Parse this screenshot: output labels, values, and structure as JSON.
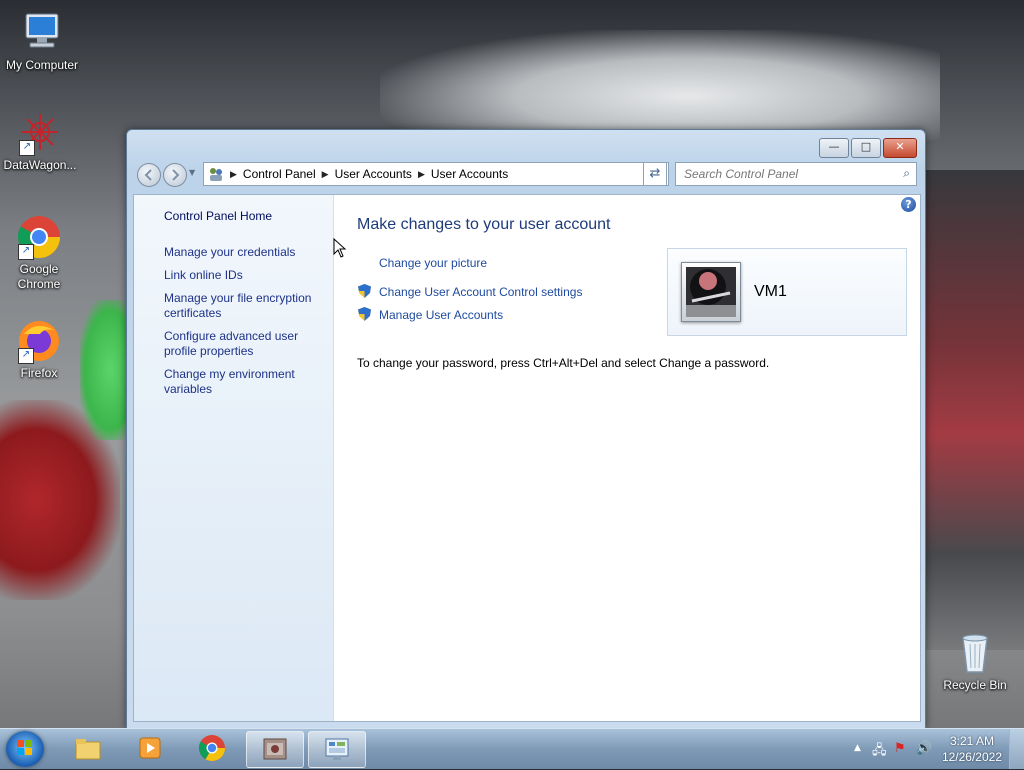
{
  "desktop": {
    "icons": [
      {
        "label": "My Computer"
      },
      {
        "label": "DataWagon..."
      },
      {
        "label": "Google Chrome"
      },
      {
        "label": "Firefox"
      },
      {
        "label": "Recycle Bin"
      }
    ]
  },
  "window": {
    "controls": {
      "minimize": "—",
      "maximize": "□",
      "close": "✕"
    },
    "breadcrumb": [
      "Control Panel",
      "User Accounts",
      "User Accounts"
    ],
    "search_placeholder": "Search Control Panel",
    "left_nav": [
      "Control Panel Home",
      "Manage your credentials",
      "Link online IDs",
      "Manage your file encryption certificates",
      "Configure advanced user profile properties",
      "Change my environment variables"
    ],
    "main": {
      "title": "Make changes to your user account",
      "tasks": [
        {
          "label": "Change your picture",
          "shield": false
        },
        {
          "label": "Change User Account Control settings",
          "shield": true
        },
        {
          "label": "Manage User Accounts",
          "shield": true
        }
      ],
      "note": "To change your password, press Ctrl+Alt+Del and select Change a password."
    },
    "user": {
      "name": "VM1"
    }
  },
  "taskbar": {
    "clock_time": "3:21 AM",
    "clock_date": "12/26/2022"
  },
  "colors": {
    "link": "#1e4a9f",
    "nav_link": "#1e3287",
    "title": "#1e3b7a"
  }
}
